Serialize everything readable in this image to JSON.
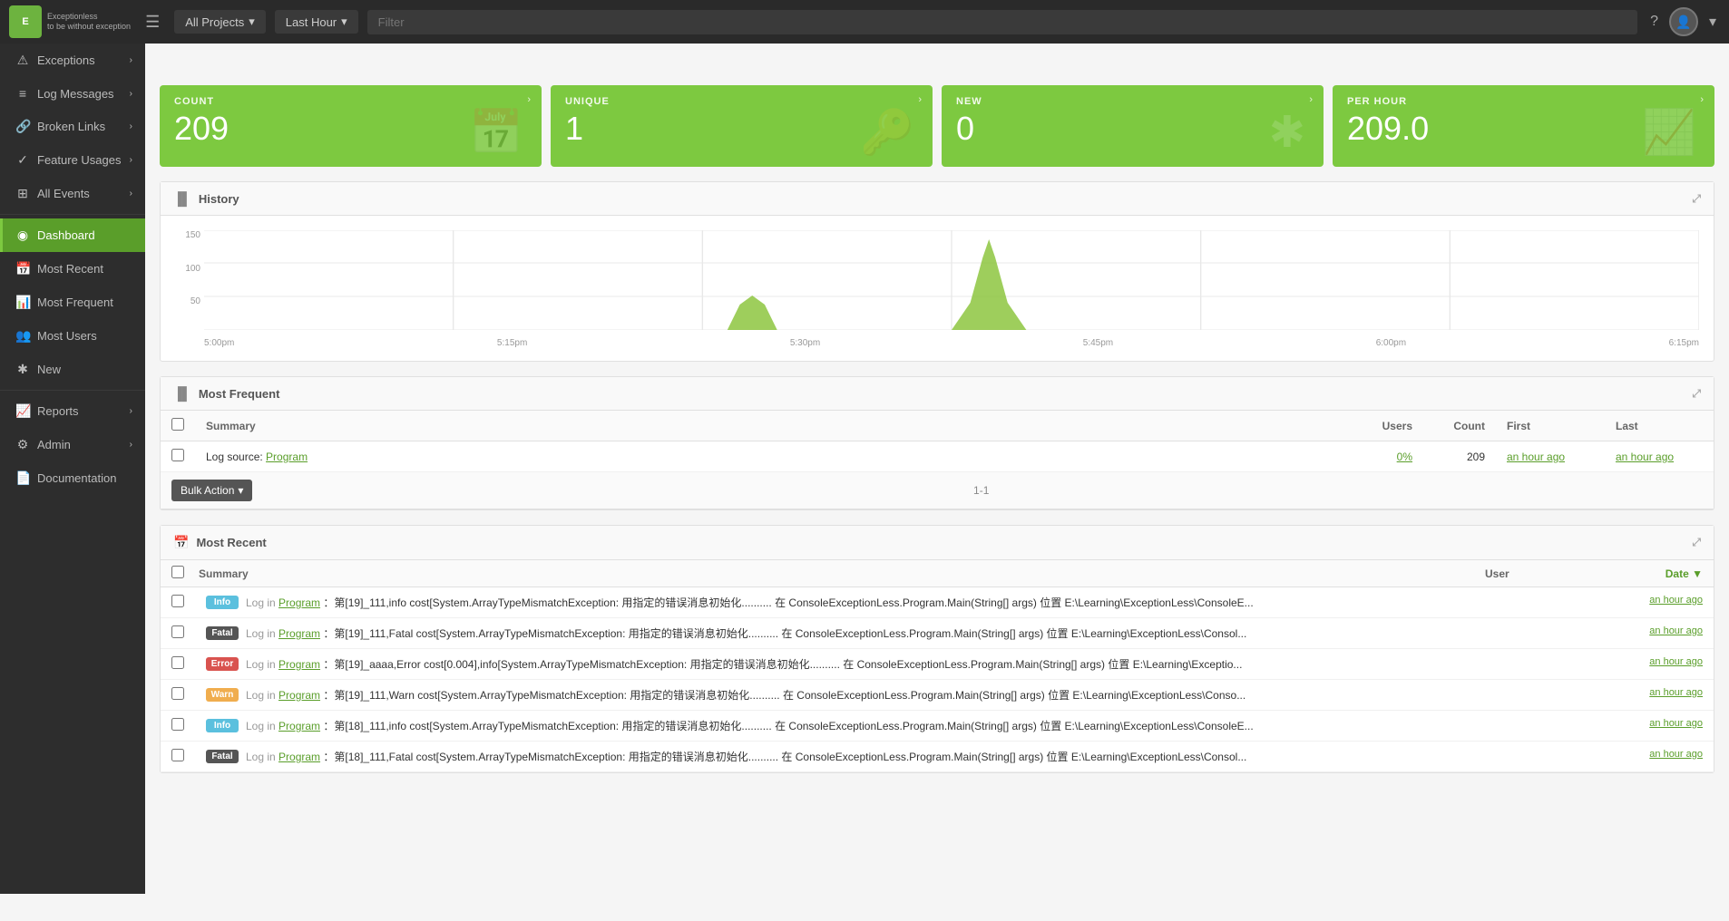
{
  "browser": {
    "url": "http://localhost:50000/#!/dashboard",
    "back_disabled": true,
    "forward_disabled": true
  },
  "topbar": {
    "logo_text": "Exceptionless",
    "logo_sub": "to be without exception",
    "hamburger": "☰",
    "projects_label": "All Projects",
    "time_label": "Last Hour",
    "filter_placeholder": "Filter",
    "help_icon": "?",
    "avatar_icon": "👤"
  },
  "sidebar": {
    "items": [
      {
        "id": "exceptions",
        "label": "Exceptions",
        "icon": "⚠",
        "has_arrow": true
      },
      {
        "id": "log-messages",
        "label": "Log Messages",
        "icon": "☰",
        "has_arrow": true
      },
      {
        "id": "broken-links",
        "label": "Broken Links",
        "icon": "🔗",
        "has_arrow": true
      },
      {
        "id": "feature-usages",
        "label": "Feature Usages",
        "icon": "✓",
        "has_arrow": true
      },
      {
        "id": "all-events",
        "label": "All Events",
        "icon": "⊞",
        "has_arrow": true
      },
      {
        "id": "dashboard",
        "label": "Dashboard",
        "icon": "◉",
        "active": true
      },
      {
        "id": "most-recent",
        "label": "Most Recent",
        "icon": "📅"
      },
      {
        "id": "most-frequent",
        "label": "Most Frequent",
        "icon": "📊"
      },
      {
        "id": "most-users",
        "label": "Most Users",
        "icon": "👥"
      },
      {
        "id": "new",
        "label": "New",
        "icon": "✱"
      },
      {
        "id": "reports",
        "label": "Reports",
        "icon": "📈",
        "has_arrow": true
      },
      {
        "id": "admin",
        "label": "Admin",
        "icon": "⚙",
        "has_arrow": true
      },
      {
        "id": "documentation",
        "label": "Documentation",
        "icon": "📄"
      }
    ]
  },
  "stat_cards": [
    {
      "id": "count",
      "label": "COUNT",
      "value": "209",
      "icon": "📅"
    },
    {
      "id": "unique",
      "label": "UNIQUE",
      "value": "1",
      "icon": "🔑"
    },
    {
      "id": "new",
      "label": "NEW",
      "value": "0",
      "icon": "✱"
    },
    {
      "id": "per-hour",
      "label": "PER HOUR",
      "value": "209.0",
      "icon": "📈"
    }
  ],
  "history": {
    "title": "History",
    "y_labels": [
      "150",
      "100",
      "50"
    ],
    "x_labels": [
      "5:00pm",
      "5:15pm",
      "5:30pm",
      "5:45pm",
      "6:00pm",
      "6:15pm"
    ]
  },
  "most_frequent": {
    "title": "Most Frequent",
    "columns": {
      "summary": "Summary",
      "users": "Users",
      "count": "Count",
      "first": "First",
      "last": "Last"
    },
    "rows": [
      {
        "source": "Program",
        "action": "Log source:",
        "users": "0%",
        "count": "209",
        "first": "an hour ago",
        "last": "an hour ago"
      }
    ],
    "pagination": "1-1",
    "bulk_action_label": "Bulk Action"
  },
  "most_recent": {
    "title": "Most Recent",
    "columns": {
      "summary": "Summary",
      "user": "User",
      "date": "Date ▼"
    },
    "rows": [
      {
        "badge": "Info",
        "badge_type": "info",
        "action": "Log in",
        "source": "Program",
        "text": "：第[19]_111,info cost[System.ArrayTypeMismatchException: 用指定的错误消息初始化.......... 在 ConsoleExceptionLess.Program.Main(String[] args) 位置 E:\\Learning\\ExceptionLess\\ConsoleE...",
        "time": "an hour ago"
      },
      {
        "badge": "Fatal",
        "badge_type": "fatal",
        "action": "Log in",
        "source": "Program",
        "text": "：第[19]_111,Fatal cost[System.ArrayTypeMismatchException: 用指定的错误消息初始化.......... 在 ConsoleExceptionLess.Program.Main(String[] args) 位置 E:\\Learning\\ExceptionLess\\Consol...",
        "time": "an hour ago"
      },
      {
        "badge": "Error",
        "badge_type": "error",
        "action": "Log in",
        "source": "Program",
        "text": "：第[19]_aaaa,Error cost[0.004],info[System.ArrayTypeMismatchException: 用指定的错误消息初始化.......... 在 ConsoleExceptionLess.Program.Main(String[] args) 位置 E:\\Learning\\Exceptio...",
        "time": "an hour ago"
      },
      {
        "badge": "Warn",
        "badge_type": "warn",
        "action": "Log in",
        "source": "Program",
        "text": "：第[19]_111,Warn cost[System.ArrayTypeMismatchException: 用指定的错误消息初始化.......... 在 ConsoleExceptionLess.Program.Main(String[] args) 位置 E:\\Learning\\ExceptionLess\\Conso...",
        "time": "an hour ago"
      },
      {
        "badge": "Info",
        "badge_type": "info",
        "action": "Log in",
        "source": "Program",
        "text": "：第[18]_111,info cost[System.ArrayTypeMismatchException: 用指定的错误消息初始化.......... 在 ConsoleExceptionLess.Program.Main(String[] args) 位置 E:\\Learning\\ExceptionLess\\ConsoleE...",
        "time": "an hour ago"
      },
      {
        "badge": "Fatal",
        "badge_type": "fatal",
        "action": "Log in",
        "source": "Program",
        "text": "：第[18]_111,Fatal cost[System.ArrayTypeMismatchException: 用指定的错误消息初始化.......... 在 ConsoleExceptionLess.Program.Main(String[] args) 位置 E:\\Learning\\ExceptionLess\\Consol...",
        "time": "an hour ago"
      }
    ]
  },
  "colors": {
    "green": "#7dc940",
    "dark_green": "#5a9e2a",
    "sidebar_bg": "#2d2d2d",
    "topbar_bg": "#2a2a2a"
  }
}
